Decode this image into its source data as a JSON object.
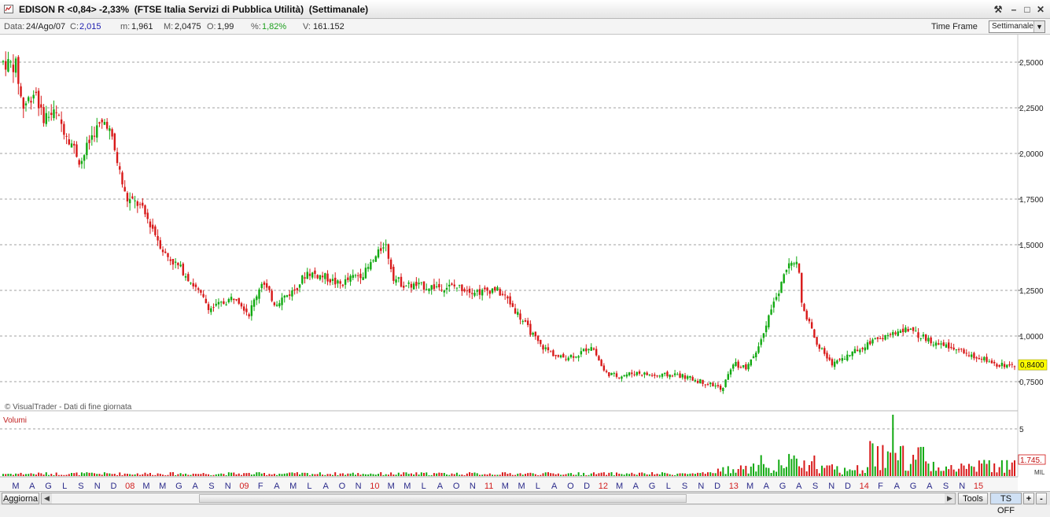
{
  "window": {
    "title": "EDISON R <0,84> -2,33%  (FTSE Italia Servizi di Pubblica Utilità)  (Settimanale)",
    "buttons": [
      "⚒",
      "–",
      "□",
      "✕"
    ]
  },
  "info": {
    "data_label": "Data:",
    "data_value": "24/Ago/07",
    "c_label": "C:",
    "c_value": "2,015",
    "m_label": "m:",
    "m_value": "1,961",
    "M_label": "M:",
    "M_value": "2,0475",
    "o_label": "O:",
    "o_value": "1,99",
    "pct_label": "%:",
    "pct_value": "1,82%",
    "v_label": "V:",
    "v_value": "161.152",
    "timeframe_label": "Time Frame",
    "timeframe_value": "Settimanale"
  },
  "chart_data": {
    "type": "candlestick",
    "price_axis": {
      "ticks": [
        "2,5000",
        "2,2500",
        "2,0000",
        "1,7500",
        "1,5000",
        "1,2500",
        "1,0000",
        "0,7500"
      ],
      "ylim": [
        0.64,
        2.6
      ]
    },
    "last_price_label": "0,8400",
    "volume_panel_label": "Volumi",
    "volume_axis": {
      "tick": "5",
      "last_label": "1.745.",
      "unit": "MIL"
    },
    "watermark": "© VisualTrader - Dati di fine giornata",
    "price_path": [
      [
        2007.2,
        2.5
      ],
      [
        2007.3,
        2.48
      ],
      [
        2007.35,
        2.25
      ],
      [
        2007.45,
        2.35
      ],
      [
        2007.5,
        2.2
      ],
      [
        2007.6,
        2.22
      ],
      [
        2007.7,
        2.1
      ],
      [
        2007.8,
        1.95
      ],
      [
        2007.9,
        2.12
      ],
      [
        2008.0,
        2.18
      ],
      [
        2008.05,
        2.05
      ],
      [
        2008.15,
        1.75
      ],
      [
        2008.25,
        1.72
      ],
      [
        2008.35,
        1.6
      ],
      [
        2008.45,
        1.45
      ],
      [
        2008.6,
        1.35
      ],
      [
        2008.7,
        1.25
      ],
      [
        2008.8,
        1.15
      ],
      [
        2008.9,
        1.18
      ],
      [
        2009.0,
        1.22
      ],
      [
        2009.1,
        1.12
      ],
      [
        2009.2,
        1.3
      ],
      [
        2009.3,
        1.18
      ],
      [
        2009.45,
        1.25
      ],
      [
        2009.55,
        1.35
      ],
      [
        2009.7,
        1.32
      ],
      [
        2009.8,
        1.28
      ],
      [
        2009.9,
        1.32
      ],
      [
        2010.0,
        1.35
      ],
      [
        2010.1,
        1.45
      ],
      [
        2010.15,
        1.52
      ],
      [
        2010.22,
        1.32
      ],
      [
        2010.3,
        1.28
      ],
      [
        2010.5,
        1.27
      ],
      [
        2010.7,
        1.27
      ],
      [
        2010.9,
        1.24
      ],
      [
        2011.0,
        1.26
      ],
      [
        2011.1,
        1.2
      ],
      [
        2011.2,
        1.1
      ],
      [
        2011.35,
        0.95
      ],
      [
        2011.5,
        0.88
      ],
      [
        2011.65,
        0.9
      ],
      [
        2011.75,
        0.95
      ],
      [
        2011.85,
        0.8
      ],
      [
        2011.95,
        0.78
      ],
      [
        2012.1,
        0.8
      ],
      [
        2012.25,
        0.78
      ],
      [
        2012.4,
        0.79
      ],
      [
        2012.55,
        0.76
      ],
      [
        2012.7,
        0.73
      ],
      [
        2012.75,
        0.7
      ],
      [
        2012.85,
        0.85
      ],
      [
        2012.95,
        0.82
      ],
      [
        2013.05,
        0.95
      ],
      [
        2013.12,
        1.12
      ],
      [
        2013.2,
        1.25
      ],
      [
        2013.28,
        1.4
      ],
      [
        2013.35,
        1.38
      ],
      [
        2013.38,
        1.15
      ],
      [
        2013.5,
        0.95
      ],
      [
        2013.6,
        0.85
      ],
      [
        2013.75,
        0.9
      ],
      [
        2013.9,
        0.97
      ],
      [
        2014.05,
        1.0
      ],
      [
        2014.15,
        1.04
      ],
      [
        2014.3,
        1.0
      ],
      [
        2014.45,
        0.95
      ],
      [
        2014.6,
        0.92
      ],
      [
        2014.75,
        0.88
      ],
      [
        2014.9,
        0.84
      ],
      [
        2015.02,
        0.84
      ]
    ],
    "x_axis_labels": [
      "M",
      "A",
      "G",
      "L",
      "S",
      "N",
      "D",
      "08",
      "M",
      "M",
      "G",
      "A",
      "S",
      "N",
      "09",
      "F",
      "A",
      "M",
      "L",
      "A",
      "O",
      "N",
      "10",
      "M",
      "M",
      "L",
      "A",
      "O",
      "N",
      "11",
      "M",
      "M",
      "L",
      "A",
      "O",
      "D",
      "12",
      "M",
      "A",
      "G",
      "L",
      "S",
      "N",
      "D",
      "13",
      "M",
      "A",
      "G",
      "A",
      "S",
      "N",
      "D",
      "14",
      "F",
      "A",
      "G",
      "A",
      "S",
      "N",
      "15"
    ]
  },
  "colors": {
    "up": "#11a911",
    "down": "#d81919",
    "grid": "#a0a0a0",
    "last_price_bg": "#ffff00",
    "year_label": "#d22020",
    "month_label": "#2a2a8a"
  },
  "bottom": {
    "aggiorna_label": "Aggiorna",
    "tools_label": "Tools",
    "tsoff_label": "TS OFF",
    "plus_label": "+",
    "minus_label": "-"
  }
}
